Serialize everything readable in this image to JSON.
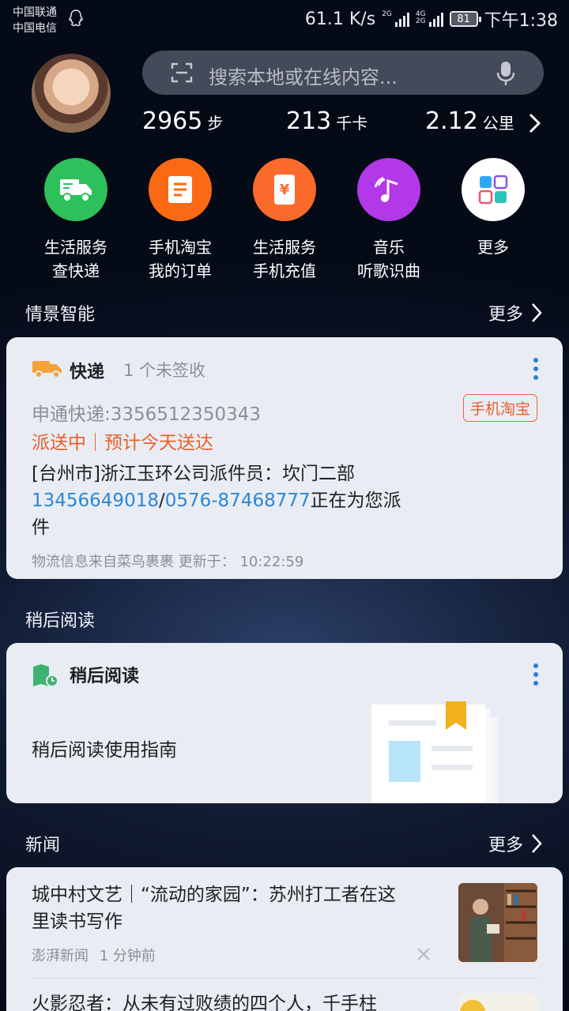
{
  "status": {
    "carrier1": "中国联通",
    "carrier2": "中国电信",
    "speed": "61.1 K/s",
    "battery": "81",
    "time": "下午1:38"
  },
  "search": {
    "placeholder": "搜索本地或在线内容..."
  },
  "stats": [
    {
      "num": "2965",
      "unit": "步"
    },
    {
      "num": "213",
      "unit": "千卡"
    },
    {
      "num": "2.12",
      "unit": "公里"
    }
  ],
  "apps": [
    {
      "line1": "生活服务",
      "line2": "查快递",
      "color": "#2ec05a"
    },
    {
      "line1": "手机淘宝",
      "line2": "我的订单",
      "color": "#fb6a12"
    },
    {
      "line1": "生活服务",
      "line2": "手机充值",
      "color": "#fa6a2a"
    },
    {
      "line1": "音乐",
      "line2": "听歌识曲",
      "color": "#b238e8"
    },
    {
      "line1": "更多",
      "line2": "",
      "color": "#ffffff"
    }
  ],
  "sections": {
    "smart": {
      "title": "情景智能",
      "more": "更多"
    },
    "later": {
      "title": "稍后阅读"
    },
    "news": {
      "title": "新闻",
      "more": "更多"
    }
  },
  "express_card": {
    "title": "快递",
    "subtitle": "1 个未签收",
    "tracking": "申通快递:3356512350343",
    "tag": "手机淘宝",
    "status": "派送中｜预计今天送达",
    "detail_prefix": "[台州市]浙江玉环公司派件员：坎门二部",
    "phone1": "13456649018",
    "slash": "/",
    "phone2": "0576-87468777",
    "detail_suffix": "正在为您派",
    "detail_wrap": "件",
    "footer": "物流信息来自菜鸟裹裹 更新于： 10:22:59"
  },
  "later_card": {
    "title": "稍后阅读",
    "guide": "稍后阅读使用指南"
  },
  "news": [
    {
      "title1": "城中村文艺｜“流动的家园”：苏州打工者在这",
      "title2": "里读书写作",
      "source": "澎湃新闻",
      "time": "1 分钟前"
    },
    {
      "title1": "火影忍者：从未有过败绩的四个人，千手柱"
    }
  ],
  "colors": {
    "accent": "#2a86d6",
    "warning": "#e8602c"
  }
}
